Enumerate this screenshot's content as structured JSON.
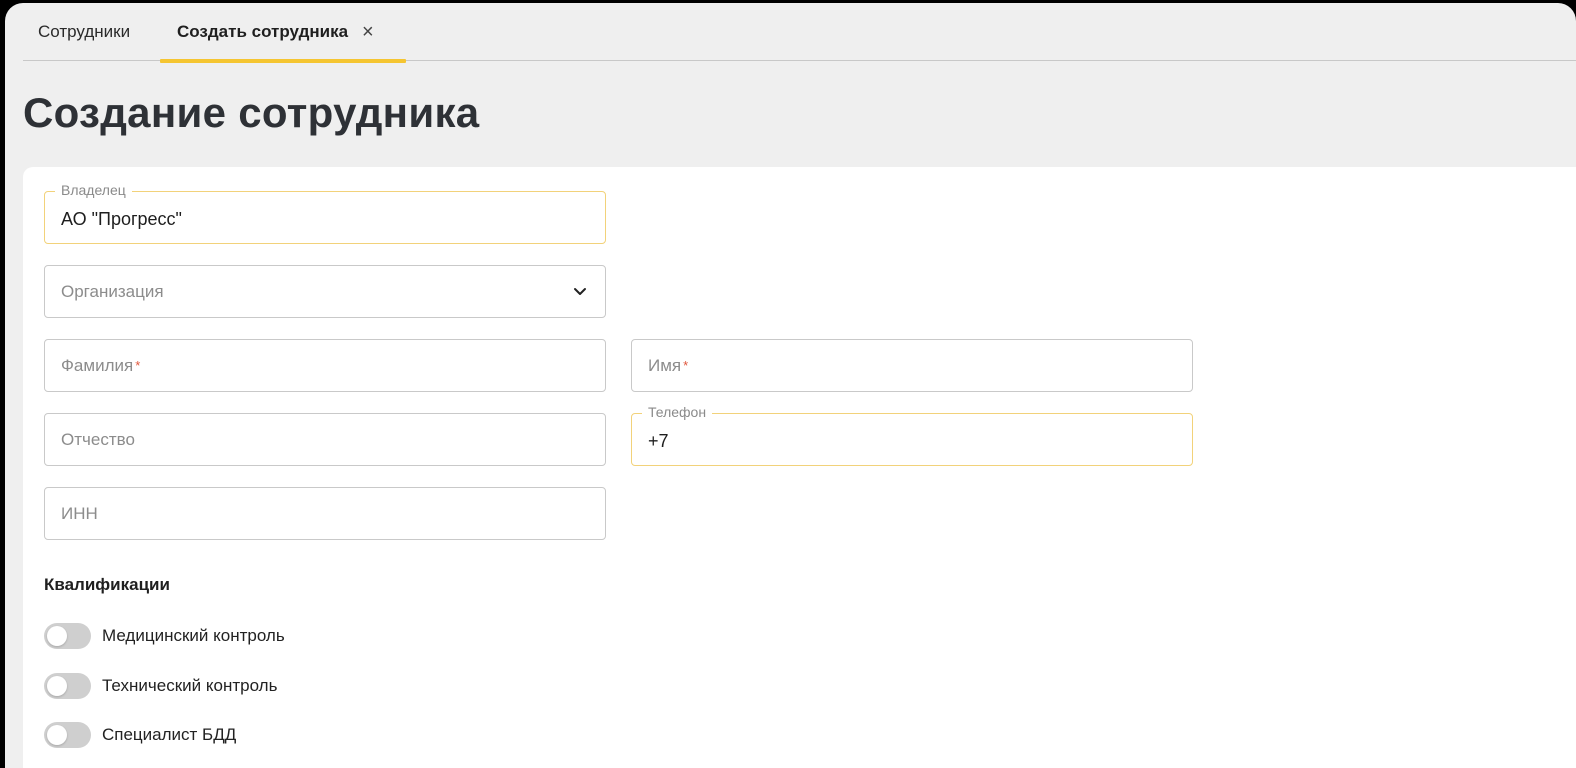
{
  "tabs": [
    {
      "label": "Сотрудники"
    },
    {
      "label": "Создать сотрудника",
      "close": "×"
    }
  ],
  "page_title": "Создание сотрудника",
  "form": {
    "owner": {
      "label": "Владелец",
      "value": "АО \"Прогресс\""
    },
    "organization": {
      "placeholder": "Организация"
    },
    "last_name": {
      "placeholder": "Фамилия",
      "required_mark": "*"
    },
    "first_name": {
      "placeholder": "Имя",
      "required_mark": "*"
    },
    "middle_name": {
      "placeholder": "Отчество"
    },
    "phone": {
      "label": "Телефон",
      "value": "+7"
    },
    "inn": {
      "placeholder": "ИНН"
    }
  },
  "qualifications": {
    "title": "Квалификации",
    "items": [
      {
        "label": "Медицинский контроль",
        "enabled": false
      },
      {
        "label": "Технический контроль",
        "enabled": false
      },
      {
        "label": "Специалист БДД",
        "enabled": false
      }
    ]
  },
  "colors": {
    "accent": "#f5c531",
    "required": "#e0563b"
  }
}
